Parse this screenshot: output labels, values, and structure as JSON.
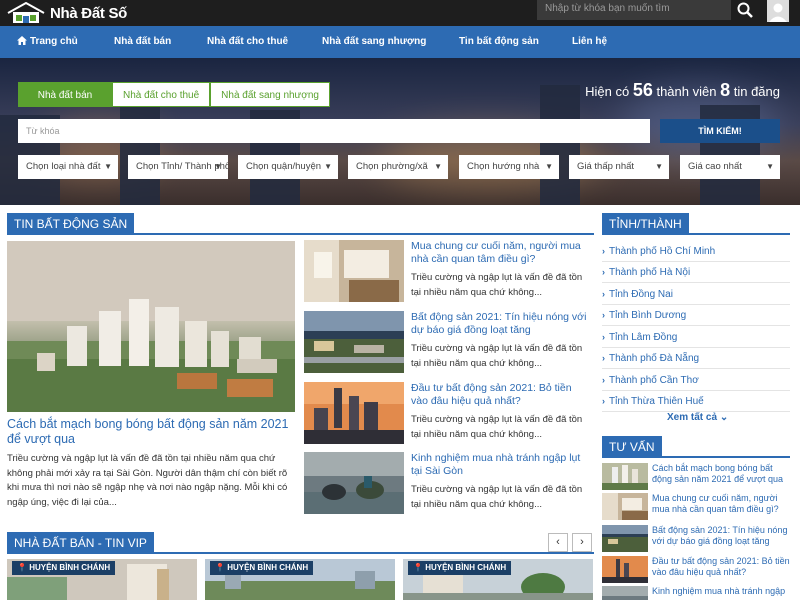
{
  "header": {
    "logo_text": "Nhà Đất Số",
    "search_placeholder": "Nhập từ khóa bạn muốn tìm"
  },
  "nav": [
    "Trang chủ",
    "Nhà đất bán",
    "Nhà đất cho thuê",
    "Nhà đất sang nhượng",
    "Tin bất động sản",
    "Liên hệ"
  ],
  "hero": {
    "tabs": [
      "Nhà đất bán",
      "Nhà đất cho thuê",
      "Nhà đất sang nhượng"
    ],
    "stat_prefix": "Hiện có",
    "members": "56",
    "stat_mid": "thành viên",
    "listings": "8",
    "stat_suffix": "tin đăng",
    "keyword_placeholder": "Từ khóa",
    "search_button": "TÌM KIẾM!",
    "selects": [
      "Chọn loại nhà đất",
      "Chọn Tỉnh/ Thành phố",
      "Chọn quận/huyện",
      "Chọn phường/xã",
      "Chọn hướng nhà",
      "Giá thấp nhất",
      "Giá cao nhất"
    ]
  },
  "news_section": {
    "title": "TIN BẤT ĐỘNG SẢN",
    "main": {
      "title": "Cách bắt mạch bong bóng bất động sản năm 2021 để vượt qua",
      "desc": "Triều cường và ngập lụt là vấn đề đã tồn tại nhiều năm qua chứ không phải mới xảy ra tại Sài Gòn. Người dân thậm chí còn biết rõ khi mưa thì nơi nào sẽ ngập nhẹ và nơi nào ngập nặng. Mỗi khi có ngập úng, việc đi lại của..."
    },
    "items": [
      {
        "title": "Mua chung cư cuối năm, người mua nhà cần quan tâm điều gì?",
        "desc": "Triều cường và ngập lụt là vấn đề đã tồn tại nhiều năm qua chứ không..."
      },
      {
        "title": "Bất động sản 2021: Tín hiệu nóng với dự báo giá đồng loạt tăng",
        "desc": "Triều cường và ngập lụt là vấn đề đã tồn tại nhiều năm qua chứ không..."
      },
      {
        "title": "Đầu tư bất động sản 2021: Bỏ tiền vào đâu hiệu quả nhất?",
        "desc": "Triều cường và ngập lụt là vấn đề đã tồn tại nhiều năm qua chứ không..."
      },
      {
        "title": "Kinh nghiệm mua nhà tránh ngập lụt tại Sài Gòn",
        "desc": "Triều cường và ngập lụt là vấn đề đã tồn tại nhiều năm qua chứ không..."
      }
    ]
  },
  "provinces": {
    "title": "TỈNH/THÀNH",
    "items": [
      "Thành phố Hồ Chí Minh",
      "Thành phố Hà Nội",
      "Tỉnh Đồng Nai",
      "Tỉnh Bình Dương",
      "Tỉnh Lâm Đồng",
      "Thành phố Đà Nẵng",
      "Thành phố Cần Thơ",
      "Tỉnh Thừa Thiên Huế"
    ],
    "more": "Xem tất cả"
  },
  "advice": {
    "title": "TƯ VẤN",
    "items": [
      "Cách bắt mạch bong bóng bất động sản năm 2021 để vượt qua",
      "Mua chung cư cuối năm, người mua nhà cần quan tâm điều gì?",
      "Bất động sản 2021: Tín hiệu nóng với dự báo giá đồng loạt tăng",
      "Đầu tư bất động sản 2021: Bỏ tiền vào đâu hiệu quả nhất?",
      "Kinh nghiệm mua nhà tránh ngập"
    ]
  },
  "vip_section": {
    "title": "NHÀ ĐẤT BÁN - TIN VIP",
    "prev": "‹",
    "next": "›",
    "badges": [
      "HUYỆN BÌNH CHÁNH",
      "HUYỆN BÌNH CHÁNH",
      "HUYỆN BÌNH CHÁNH"
    ]
  },
  "colors": {
    "primary": "#2d6bb3",
    "green": "#5aa12e",
    "dark": "#1e1e1e",
    "button": "#1b4f8a"
  }
}
